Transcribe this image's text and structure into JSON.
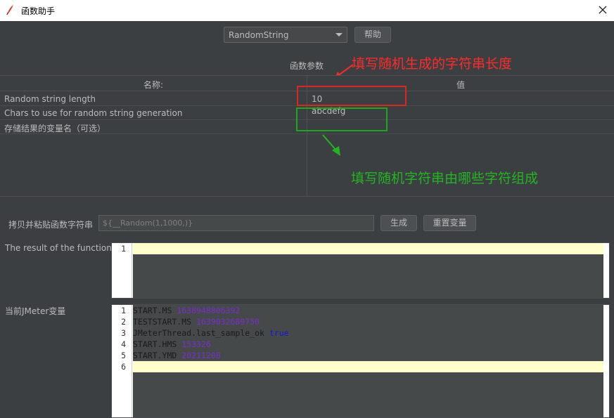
{
  "window": {
    "title": "函数助手",
    "close_icon": "close-icon"
  },
  "toolbar": {
    "function_select": "RandomString",
    "help_label": "帮助"
  },
  "params": {
    "section_label": "函数参数",
    "col_name": "名称:",
    "col_value": "值",
    "rows": [
      {
        "name": "Random string length",
        "value": "10"
      },
      {
        "name": "Chars to use for random string generation",
        "value": "abcdefg"
      },
      {
        "name": "存储结果的变量名（可选）",
        "value": ""
      }
    ]
  },
  "annotations": {
    "red_text": "填写随机生成的字符串长度",
    "red_color": "#ff2a2a",
    "green_text": "填写随机字符串由哪些字符组成",
    "green_color": "#22b522"
  },
  "copy": {
    "label": "拷贝并粘贴函数字符串",
    "value": "${__Random(1,1000,)}",
    "generate_label": "生成",
    "reset_label": "重置变量"
  },
  "result": {
    "label": "The result of the function is",
    "line_number": "1"
  },
  "vars": {
    "label": "当前JMeter变量",
    "lines": [
      {
        "num": "1",
        "key": "START.MS",
        "value": "1638948806392",
        "type": "number"
      },
      {
        "num": "2",
        "key": "TESTSTART.MS",
        "value": "1639032689750",
        "type": "number"
      },
      {
        "num": "3",
        "key": "JMeterThread.last_sample_ok",
        "value": "true",
        "type": "bool"
      },
      {
        "num": "4",
        "key": "START.HMS",
        "value": "153326",
        "type": "number"
      },
      {
        "num": "5",
        "key": "START.YMD",
        "value": "20211208",
        "type": "number"
      },
      {
        "num": "6",
        "key": "",
        "value": "",
        "type": ""
      }
    ]
  }
}
